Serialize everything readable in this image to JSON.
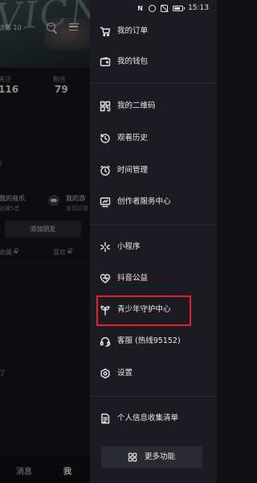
{
  "status_bar": {
    "time": "15:13",
    "notification_count": "N"
  },
  "profile_background": {
    "visitors_label": "访客 10",
    "following_label": "关注",
    "following_count": "116",
    "followers_label": "粉丝",
    "followers_count": "79",
    "side_char": "2",
    "music_title": "我的音乐",
    "music_sub": "收藏5首",
    "game_title": "我的游",
    "game_sub": "发现好游",
    "add_friend_label": "添加朋友",
    "tab_collection": "收藏",
    "tab_likes": "喜欢",
    "tail_char": "了",
    "bottom_tabs": {
      "messages": "消息",
      "me": "我"
    }
  },
  "drawer": {
    "items": [
      {
        "label": "我的订单",
        "icon": "cart-icon"
      },
      {
        "label": "我的钱包",
        "icon": "wallet-icon"
      },
      {
        "label": "我的二维码",
        "icon": "qrcode-icon"
      },
      {
        "label": "观看历史",
        "icon": "history-icon"
      },
      {
        "label": "时间管理",
        "icon": "alarm-clock-icon"
      },
      {
        "label": "创作者服务中心",
        "icon": "creator-icon"
      },
      {
        "label": "小程序",
        "icon": "mini-program-icon"
      },
      {
        "label": "抖音公益",
        "icon": "charity-heart-icon"
      },
      {
        "label": "青少年守护中心",
        "icon": "sprout-icon"
      },
      {
        "label": "客服 (热线95152)",
        "icon": "headset-icon"
      },
      {
        "label": "设置",
        "icon": "settings-icon"
      },
      {
        "label": "个人信息收集清单",
        "icon": "document-list-icon"
      }
    ],
    "more_button_label": "更多功能",
    "highlight_color": "#e3222a"
  }
}
